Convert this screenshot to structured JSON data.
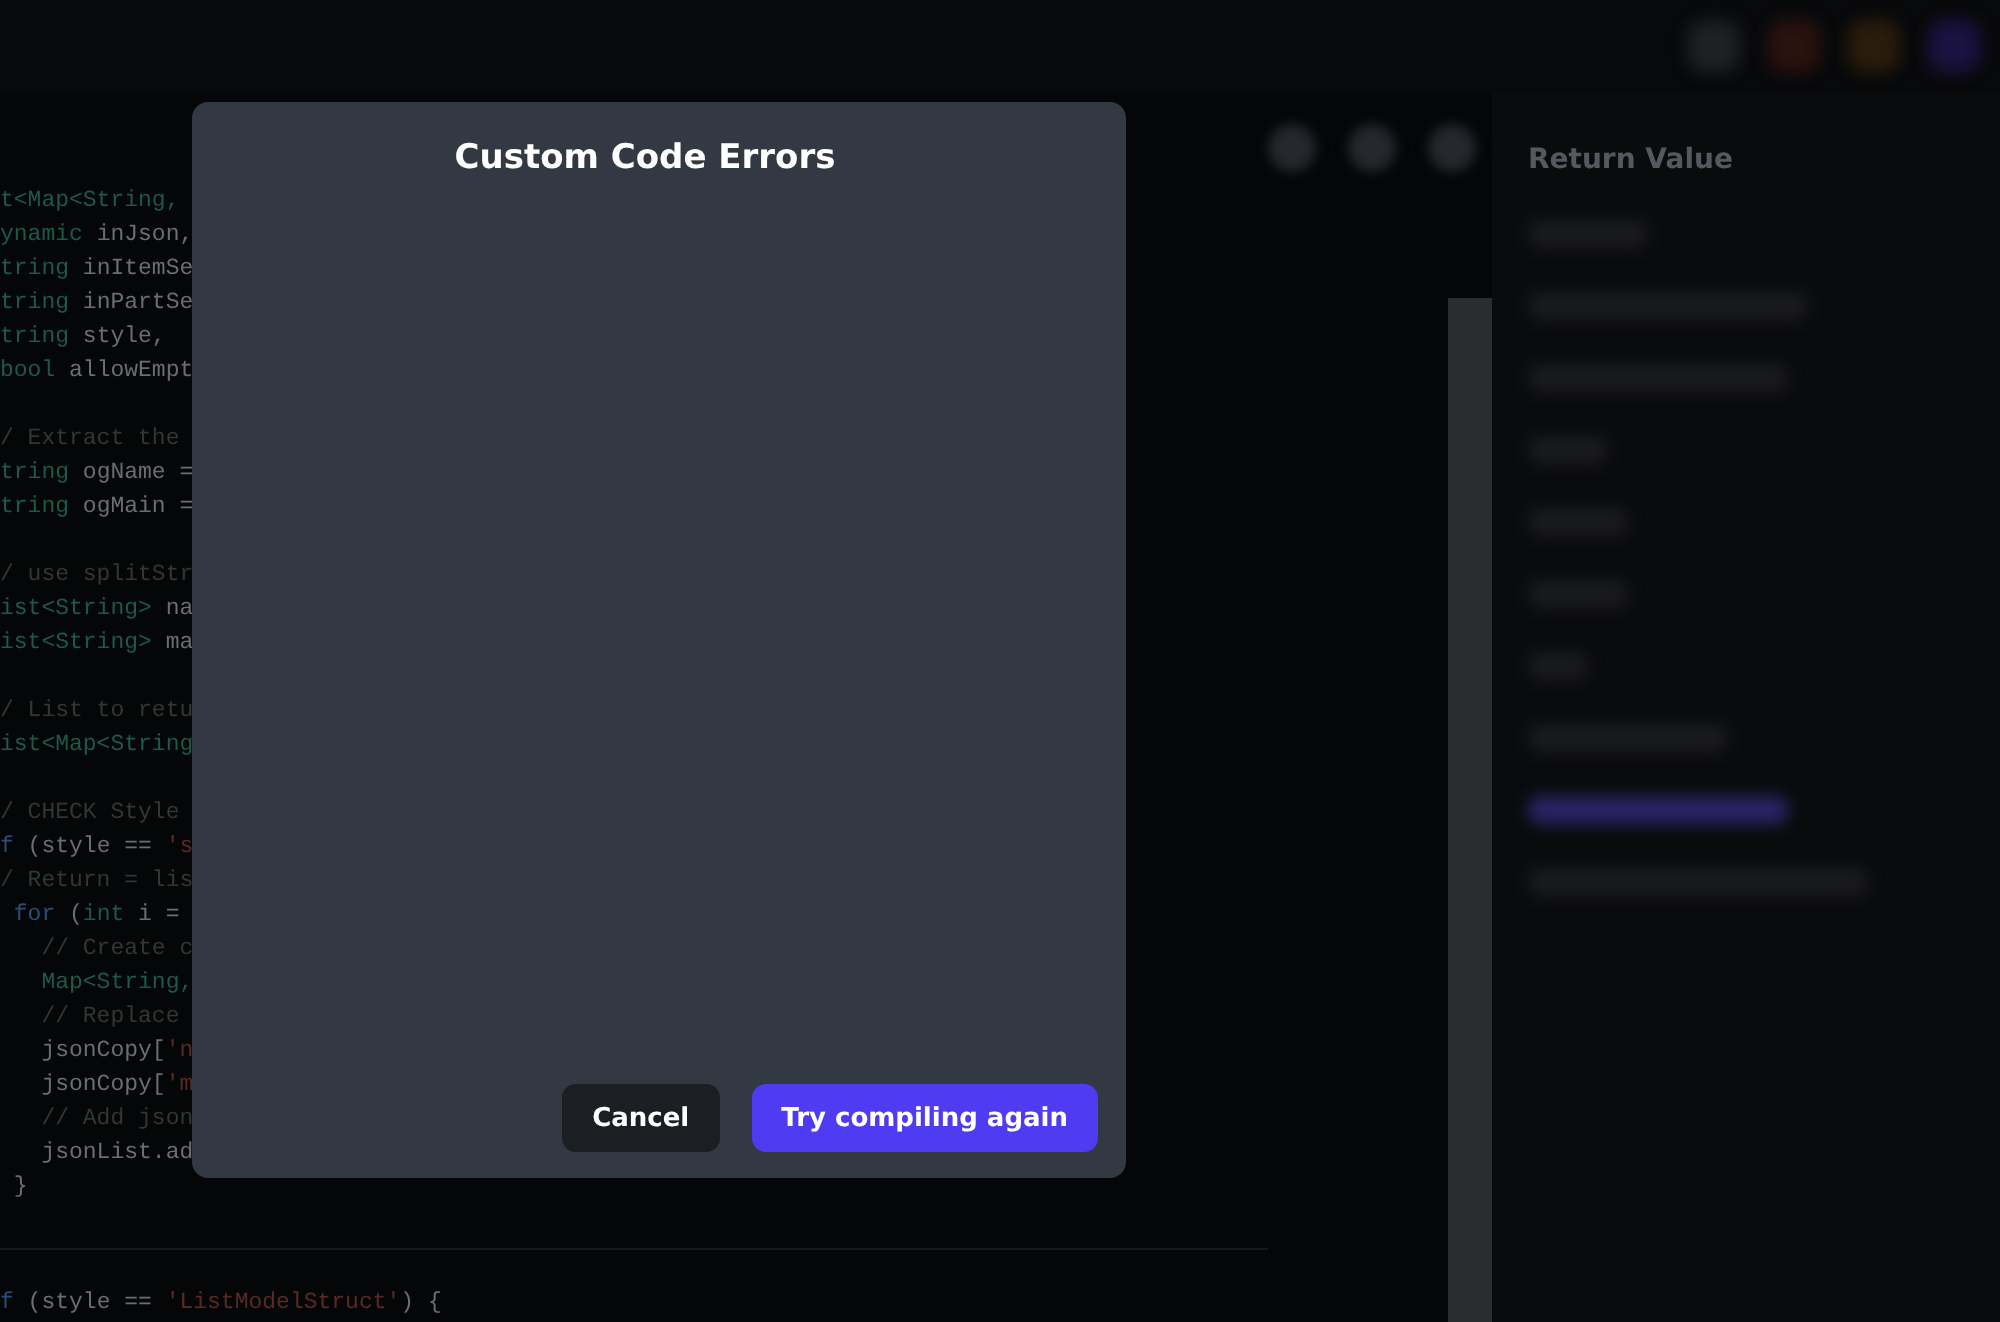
{
  "code_blocks": [
    [
      [
        {
          "kind": "type",
          "text": "t<Map<String,"
        }
      ],
      [
        {
          "kind": "type",
          "text": "ynamic"
        },
        {
          "kind": "plain",
          "text": " inJson,"
        }
      ],
      [
        {
          "kind": "type",
          "text": "tring"
        },
        {
          "kind": "plain",
          "text": " inItemSe"
        }
      ],
      [
        {
          "kind": "type",
          "text": "tring"
        },
        {
          "kind": "plain",
          "text": " inPartSe"
        }
      ],
      [
        {
          "kind": "type",
          "text": "tring"
        },
        {
          "kind": "plain",
          "text": " style,"
        }
      ],
      [
        {
          "kind": "type",
          "text": "bool"
        },
        {
          "kind": "plain",
          "text": " allowEmpt"
        }
      ]
    ],
    [
      [
        {
          "kind": "comment",
          "text": "/ Extract the"
        }
      ],
      [
        {
          "kind": "type",
          "text": "tring"
        },
        {
          "kind": "plain",
          "text": " ogName ="
        }
      ],
      [
        {
          "kind": "type",
          "text": "tring"
        },
        {
          "kind": "plain",
          "text": " ogMain ="
        }
      ]
    ],
    [
      [
        {
          "kind": "comment",
          "text": "/ use splitStr"
        }
      ],
      [
        {
          "kind": "type",
          "text": "ist<String>"
        },
        {
          "kind": "plain",
          "text": " na"
        }
      ],
      [
        {
          "kind": "type",
          "text": "ist<String>"
        },
        {
          "kind": "plain",
          "text": " ma"
        }
      ]
    ],
    [
      [
        {
          "kind": "comment",
          "text": "/ List to retu"
        }
      ],
      [
        {
          "kind": "type",
          "text": "ist<Map<String"
        }
      ]
    ],
    [
      [
        {
          "kind": "comment",
          "text": "/ CHECK Style"
        }
      ],
      [
        {
          "kind": "keyword",
          "text": "f"
        },
        {
          "kind": "plain",
          "text": " (style == "
        },
        {
          "kind": "string",
          "text": "'s"
        }
      ],
      [
        {
          "kind": "comment",
          "text": "/ Return = lis"
        }
      ],
      [
        {
          "kind": "keyword",
          "text": " for"
        },
        {
          "kind": "plain",
          "text": " ("
        },
        {
          "kind": "type",
          "text": "int"
        },
        {
          "kind": "plain",
          "text": " i ="
        }
      ],
      [
        {
          "kind": "comment",
          "text": "   // Create c"
        }
      ],
      [
        {
          "kind": "type",
          "text": "   Map<String,"
        }
      ],
      [
        {
          "kind": "comment",
          "text": "   // Replace"
        }
      ],
      [
        {
          "kind": "plain",
          "text": "   jsonCopy["
        },
        {
          "kind": "string",
          "text": "'n"
        }
      ],
      [
        {
          "kind": "plain",
          "text": "   jsonCopy["
        },
        {
          "kind": "string",
          "text": "'m"
        }
      ],
      [
        {
          "kind": "comment",
          "text": "   // Add json"
        }
      ],
      [
        {
          "kind": "plain",
          "text": "   jsonList.ad"
        }
      ],
      [
        {
          "kind": "plain",
          "text": " }"
        }
      ]
    ]
  ],
  "code_lines_below": [
    [
      {
        "kind": "keyword",
        "text": "f"
      },
      {
        "kind": "plain",
        "text": " (style == "
      },
      {
        "kind": "string",
        "text": "'ListModelStruct'"
      },
      {
        "kind": "plain",
        "text": ") {"
      }
    ]
  ],
  "side_panel": {
    "title": "Return Value"
  },
  "dialog": {
    "title": "Custom Code Errors",
    "buttons": [
      {
        "kind": "secondary",
        "label": "Cancel"
      },
      {
        "kind": "primary",
        "label": "Try compiling again"
      }
    ]
  }
}
